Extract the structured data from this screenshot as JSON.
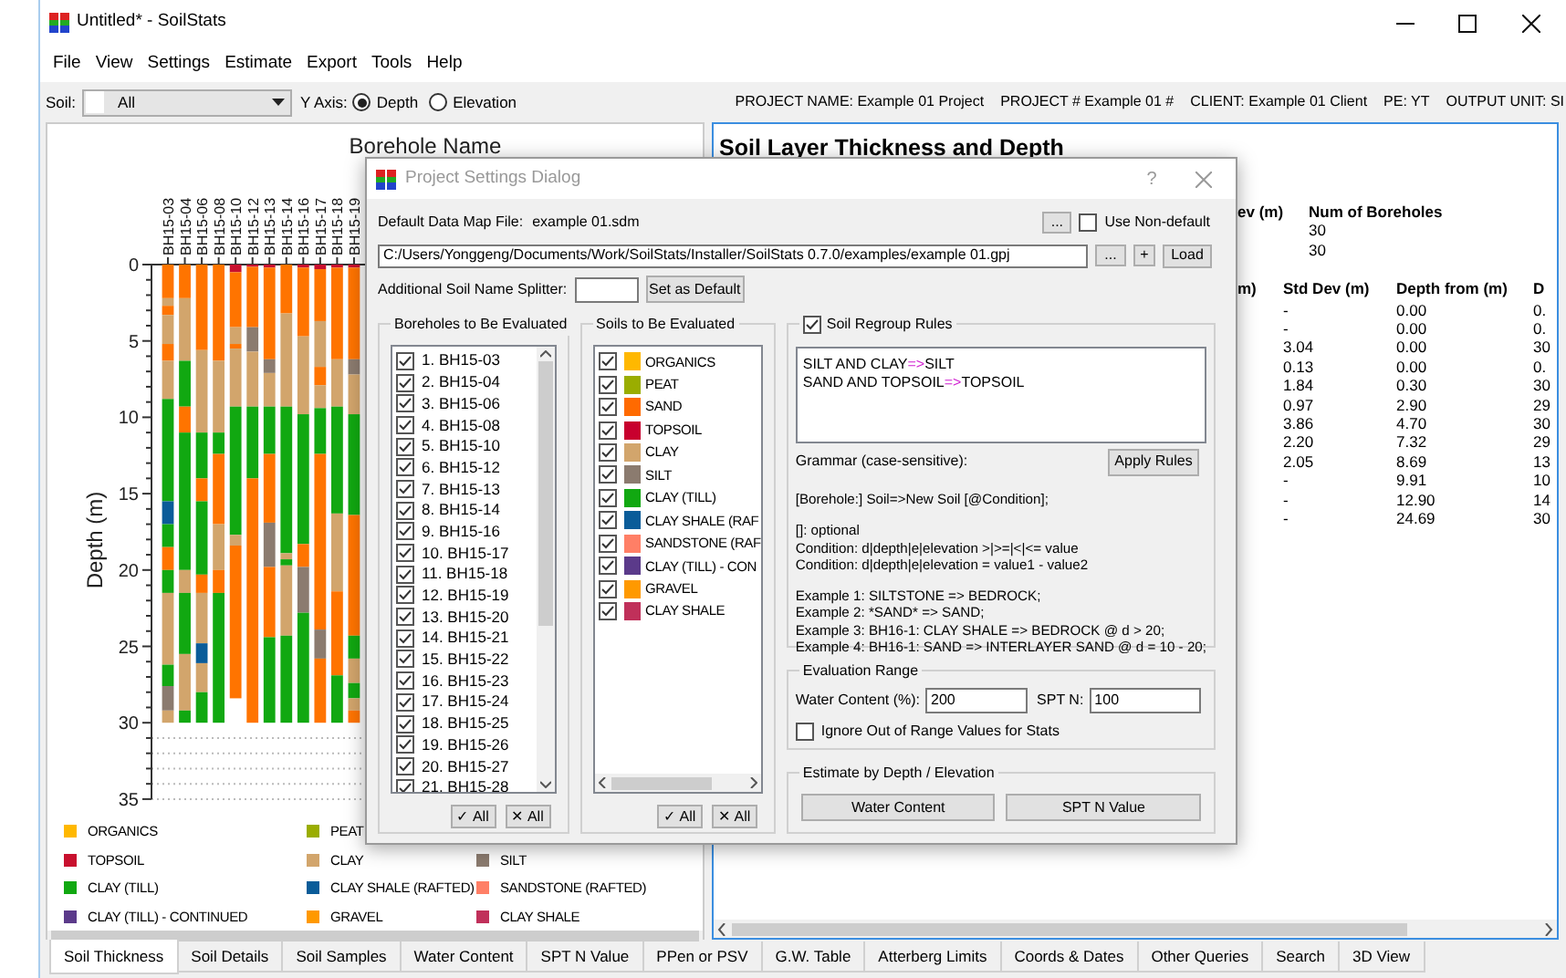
{
  "window": {
    "title": "Untitled* - SoilStats"
  },
  "menu": [
    "File",
    "View",
    "Settings",
    "Estimate",
    "Export",
    "Tools",
    "Help"
  ],
  "toolbar": {
    "soil_label": "Soil:",
    "soil_value": "All",
    "y_axis_label": "Y Axis:",
    "y_axis_options": [
      {
        "label": "Depth",
        "selected": true
      },
      {
        "label": "Elevation",
        "selected": false
      }
    ],
    "project_info": [
      "PROJECT NAME: Example 01 Project",
      "PROJECT # Example 01 #",
      "CLIENT: Example 01 Client",
      "PE: YT",
      "OUTPUT UNIT: SI"
    ]
  },
  "chart": {
    "title": "Borehole Name",
    "ylabel": "Depth (m)",
    "yticks": [
      "0",
      "5",
      "10",
      "15",
      "20",
      "25",
      "30",
      "35"
    ],
    "boreholes": [
      "BH15-03",
      "BH15-04",
      "BH15-06",
      "BH15-08",
      "BH15-10",
      "BH15-12",
      "BH15-13",
      "BH15-14",
      "BH15-16",
      "BH15-17",
      "BH15-18",
      "BH15-19"
    ],
    "legend": [
      {
        "label": "ORGANICS",
        "color": "#ffb800"
      },
      {
        "label": "PEAT",
        "color": "#9aad00"
      },
      {
        "label": "TOPSOIL",
        "color": "#c8102e"
      },
      {
        "label": "CLAY",
        "color": "#d2a56c"
      },
      {
        "label": "SILT",
        "color": "#8b7b6f"
      },
      {
        "label": "CLAY (TILL)",
        "color": "#11a811"
      },
      {
        "label": "CLAY SHALE (RAFTED)",
        "color": "#0a5c99"
      },
      {
        "label": "SANDSTONE (RAFTED)",
        "color": "#ff7f66"
      },
      {
        "label": "CLAY (TILL) - CONTINUED",
        "color": "#5b3a8a"
      },
      {
        "label": "GRAVEL",
        "color": "#ff9900"
      },
      {
        "label": "CLAY SHALE",
        "color": "#c0305a"
      }
    ]
  },
  "results": {
    "title": "Soil Layer Thickness and Depth",
    "summary_columns": [
      "ev (m)",
      "Num of Boreholes"
    ],
    "summary_values": [
      "30",
      "30"
    ],
    "stats_columns": [
      "m)",
      "Std Dev (m)",
      "Depth from (m)",
      "D"
    ],
    "stats_rows": [
      {
        "std_dev": "-",
        "depth_from": "0.00",
        "column_4": "0."
      },
      {
        "std_dev": "-",
        "depth_from": "0.00",
        "column_4": "0."
      },
      {
        "std_dev": "3.04",
        "depth_from": "0.00",
        "column_4": "30"
      },
      {
        "std_dev": "0.13",
        "depth_from": "0.00",
        "column_4": "0."
      },
      {
        "std_dev": "1.84",
        "depth_from": "0.30",
        "column_4": "30"
      },
      {
        "std_dev": "0.97",
        "depth_from": "2.90",
        "column_4": "29"
      },
      {
        "std_dev": "3.86",
        "depth_from": "4.70",
        "column_4": "30"
      },
      {
        "std_dev": "2.20",
        "depth_from": "7.32",
        "column_4": "29"
      },
      {
        "std_dev": "2.05",
        "depth_from": "8.69",
        "column_4": "13"
      },
      {
        "std_dev": "-",
        "depth_from": "9.91",
        "column_4": "10"
      },
      {
        "std_dev": "-",
        "depth_from": "12.90",
        "column_4": "14"
      },
      {
        "std_dev": "-",
        "depth_from": "24.69",
        "column_4": "30"
      }
    ]
  },
  "dialog": {
    "title": "Project Settings Dialog",
    "help_button": "?",
    "data_map_label": "Default Data Map File:",
    "data_map_value": "example 01.sdm",
    "browse_map": "...",
    "use_non_default": {
      "label": "Use Non-default",
      "checked": false
    },
    "project_path": "C:/Users/Yonggeng/Documents/Work/SoilStats/Installer/SoilStats 0.7.0/examples/example 01.gpj",
    "browse_project": "...",
    "add_project": "+",
    "load": "Load",
    "splitter_label": "Additional Soil Name Splitter:",
    "set_default": "Set as Default",
    "boreholes_group": {
      "title": "Boreholes to Be Evaluated",
      "check_all": "✓ All",
      "uncheck_all": "✕ All",
      "items": [
        {
          "label": "1. BH15-03",
          "checked": true
        },
        {
          "label": "2. BH15-04",
          "checked": true
        },
        {
          "label": "3. BH15-06",
          "checked": true
        },
        {
          "label": "4. BH15-08",
          "checked": true
        },
        {
          "label": "5. BH15-10",
          "checked": true
        },
        {
          "label": "6. BH15-12",
          "checked": true
        },
        {
          "label": "7. BH15-13",
          "checked": true
        },
        {
          "label": "8. BH15-14",
          "checked": true
        },
        {
          "label": "9. BH15-16",
          "checked": true
        },
        {
          "label": "10. BH15-17",
          "checked": true
        },
        {
          "label": "11. BH15-18",
          "checked": true
        },
        {
          "label": "12. BH15-19",
          "checked": true
        },
        {
          "label": "13. BH15-20",
          "checked": true
        },
        {
          "label": "14. BH15-21",
          "checked": true
        },
        {
          "label": "15. BH15-22",
          "checked": true
        },
        {
          "label": "16. BH15-23",
          "checked": true
        },
        {
          "label": "17. BH15-24",
          "checked": true
        },
        {
          "label": "18. BH15-25",
          "checked": true
        },
        {
          "label": "19. BH15-26",
          "checked": true
        },
        {
          "label": "20. BH15-27",
          "checked": true
        },
        {
          "label": "21. BH15-28",
          "checked": true
        }
      ]
    },
    "soils_group": {
      "title": "Soils to Be Evaluated",
      "check_all": "✓ All",
      "uncheck_all": "✕ All",
      "items": [
        {
          "label": "ORGANICS",
          "color": "#ffb800",
          "checked": true
        },
        {
          "label": "PEAT",
          "color": "#9aad00",
          "checked": true
        },
        {
          "label": "SAND",
          "color": "#ff6a00",
          "checked": true
        },
        {
          "label": "TOPSOIL",
          "color": "#c8002e",
          "checked": true
        },
        {
          "label": "CLAY",
          "color": "#d2a56c",
          "checked": true
        },
        {
          "label": "SILT",
          "color": "#8b7b6f",
          "checked": true
        },
        {
          "label": "CLAY (TILL)",
          "color": "#11a811",
          "checked": true
        },
        {
          "label": "CLAY SHALE (RAF",
          "color": "#0a5c99",
          "checked": true
        },
        {
          "label": "SANDSTONE (RAF",
          "color": "#ff7f66",
          "checked": true
        },
        {
          "label": "CLAY (TILL) - CON",
          "color": "#5b3a8a",
          "checked": true
        },
        {
          "label": "GRAVEL",
          "color": "#ff9900",
          "checked": true
        },
        {
          "label": "CLAY SHALE",
          "color": "#c0305a",
          "checked": true
        }
      ]
    },
    "regroup": {
      "title": "Soil Regroup Rules",
      "checked": true,
      "rules": [
        {
          "source": "SILT AND CLAY",
          "arrow": "=>",
          "target": "SILT"
        },
        {
          "source": "SAND AND TOPSOIL",
          "arrow": "=>",
          "target": "TOPSOIL"
        }
      ],
      "grammar_label": "Grammar (case-sensitive):",
      "apply": "Apply Rules",
      "help_blocks": [
        [
          "[Borehole:] Soil=>New Soil [@Condition];"
        ],
        [
          "[]: optional",
          "Condition: d|depth|e|elevation >|>=|<|<= value",
          "Condition: d|depth|e|elevation = value1 - value2"
        ],
        [
          "Example 1: SILTSTONE => BEDROCK;",
          "Example 2: *SAND* => SAND;",
          "Example 3: BH16-1: CLAY SHALE => BEDROCK @ d > 20;",
          "Example 4: BH16-1: SAND => INTERLAYER SAND @ d = 10 - 20;"
        ]
      ]
    },
    "evaluation": {
      "title": "Evaluation Range",
      "water_label": "Water Content (%):",
      "water_value": "200",
      "spt_label": "SPT N:",
      "spt_value": "100",
      "ignore": {
        "label": "Ignore Out of Range Values for Stats",
        "checked": false
      }
    },
    "estimate": {
      "title": "Estimate by Depth / Elevation",
      "buttons": [
        "Water Content",
        "SPT N Value"
      ]
    }
  },
  "tabs": [
    {
      "label": "Soil Thickness",
      "selected": true
    },
    {
      "label": "Soil Details",
      "selected": false
    },
    {
      "label": "Soil Samples",
      "selected": false
    },
    {
      "label": "Water Content",
      "selected": false
    },
    {
      "label": "SPT N Value",
      "selected": false
    },
    {
      "label": "PPen or PSV",
      "selected": false
    },
    {
      "label": "G.W. Table",
      "selected": false
    },
    {
      "label": "Atterberg Limits",
      "selected": false
    },
    {
      "label": "Coords & Dates",
      "selected": false
    },
    {
      "label": "Other Queries",
      "selected": false
    },
    {
      "label": "Search",
      "selected": false
    },
    {
      "label": "3D View",
      "selected": false
    }
  ]
}
